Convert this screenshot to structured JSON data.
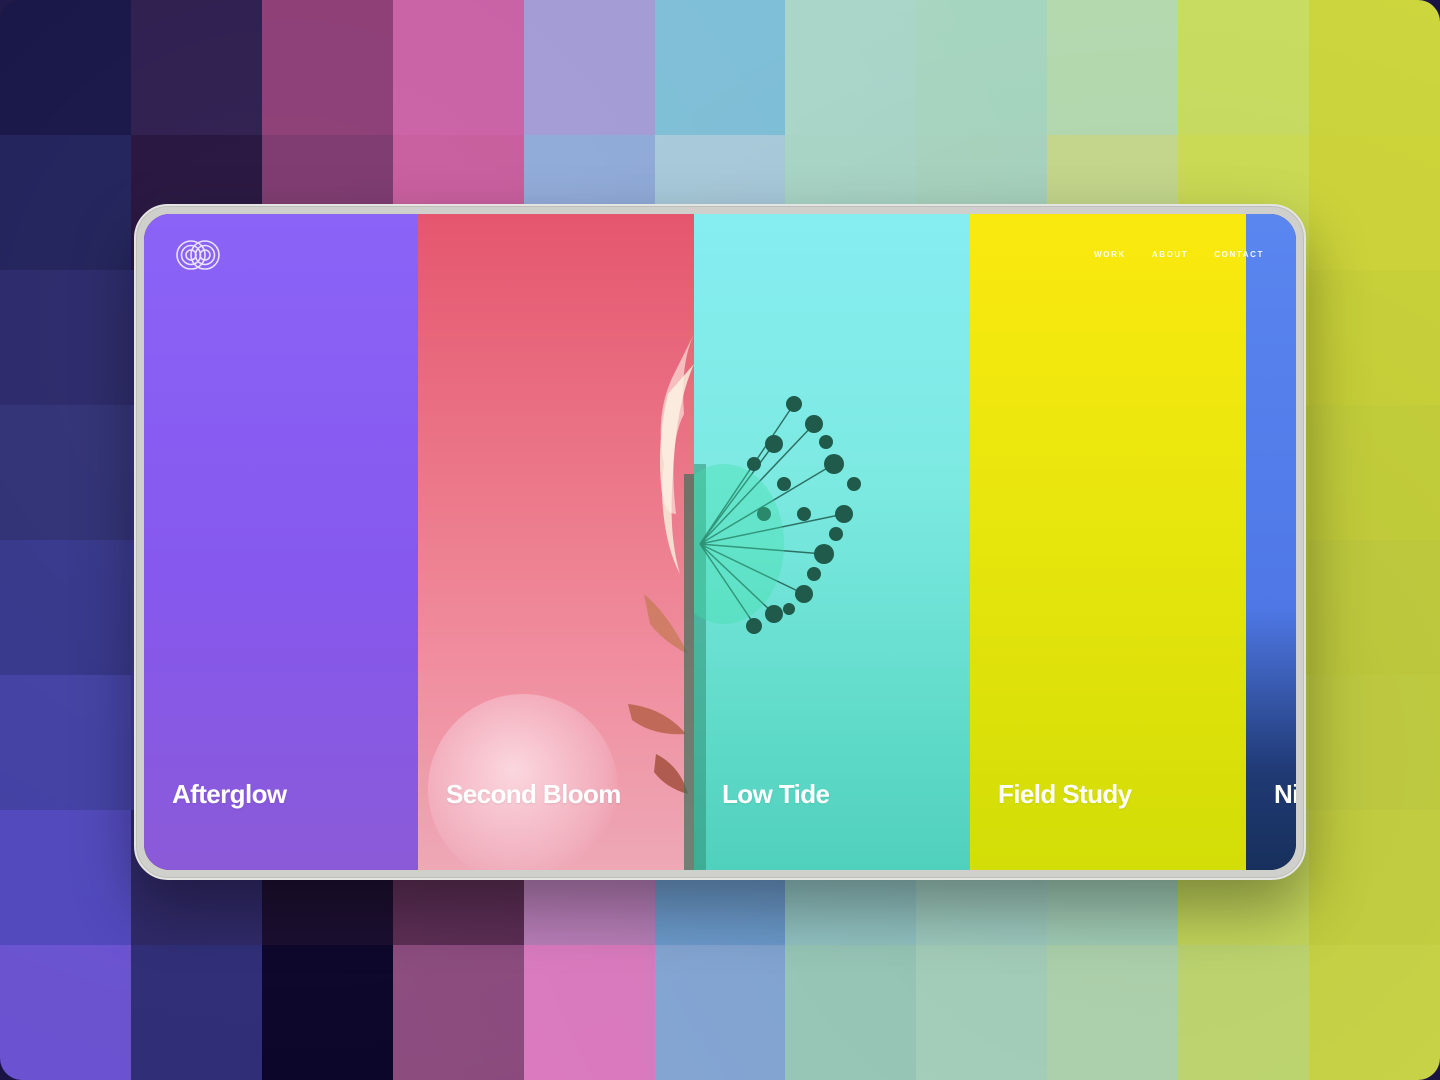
{
  "background": {
    "columns": [
      [
        "#141244",
        "#1d1e58",
        "#272567",
        "#2d2e74",
        "#34348a",
        "#4140a3",
        "#5048bc",
        "#6a52d0"
      ],
      [
        "#2a1a4c",
        "#220f3b",
        "#2a2464",
        "#332f78",
        "#3c3690",
        "#3d3a92",
        "#2d2766",
        "#2e2d76"
      ],
      [
        "#8a3a73",
        "#7a356c",
        "#5a2757",
        "#3c2156",
        "#33215a",
        "#351f4d",
        "#190c2e",
        "#0b052a"
      ],
      [
        "#c95fa4",
        "#c75a9b",
        "#b14f8f",
        "#a34583",
        "#943a73",
        "#8a3a6c",
        "#5b2c54",
        "#8c4b7e"
      ],
      [
        "#a29ad4",
        "#8ea9d8",
        "#8b93cf",
        "#7f8bc8",
        "#7a80c2",
        "#8d79b8",
        "#b97fb9",
        "#dd7bc1"
      ],
      [
        "#7dbed6",
        "#a6c9d9",
        "#96c4d7",
        "#8fbfd6",
        "#86b4d4",
        "#7cb0d2",
        "#6c9cce",
        "#86a8d6"
      ],
      [
        "#a9d6c9",
        "#a8d5c6",
        "#a4d2c4",
        "#9fd0c3",
        "#9bcdc0",
        "#93cac0",
        "#95c7c6",
        "#9bcbbb"
      ],
      [
        "#a7d6c0",
        "#a9d4bf",
        "#b1d5b8",
        "#b6d7b3",
        "#aed4b7",
        "#a7d2bd",
        "#a2d0c3",
        "#a9d4bf"
      ],
      [
        "#b5dab0",
        "#c6d98d",
        "#bdd5a2",
        "#b6d5ab",
        "#b3d5ae",
        "#add4b4",
        "#a6d3bb",
        "#b3d8b2"
      ],
      [
        "#c9dd62",
        "#cddd55",
        "#cfdd47",
        "#c8d940",
        "#c4d741",
        "#c7da55",
        "#c9dc5e",
        "#c3db73"
      ],
      [
        "#cdd63d",
        "#cfd63b",
        "#cbd43a",
        "#c7d23c",
        "#c4cf3f",
        "#c5d143",
        "#c9d442",
        "#cdd848"
      ]
    ]
  },
  "logo": {
    "icon": "intertwined-loops-logo",
    "color": "#e9e4ff"
  },
  "nav": {
    "items": [
      {
        "label": "WORK"
      },
      {
        "label": "ABOUT"
      },
      {
        "label": "CONTACT"
      }
    ]
  },
  "panels": [
    {
      "title": "Afterglow",
      "color": "#8b63f7"
    },
    {
      "title": "Second Bloom",
      "color": "#ec6f83"
    },
    {
      "title": "Low Tide",
      "color": "#7deae2"
    },
    {
      "title": "Field Study",
      "color": "#e8e60d"
    },
    {
      "title": "Ni",
      "color": "#5a86f0"
    }
  ]
}
